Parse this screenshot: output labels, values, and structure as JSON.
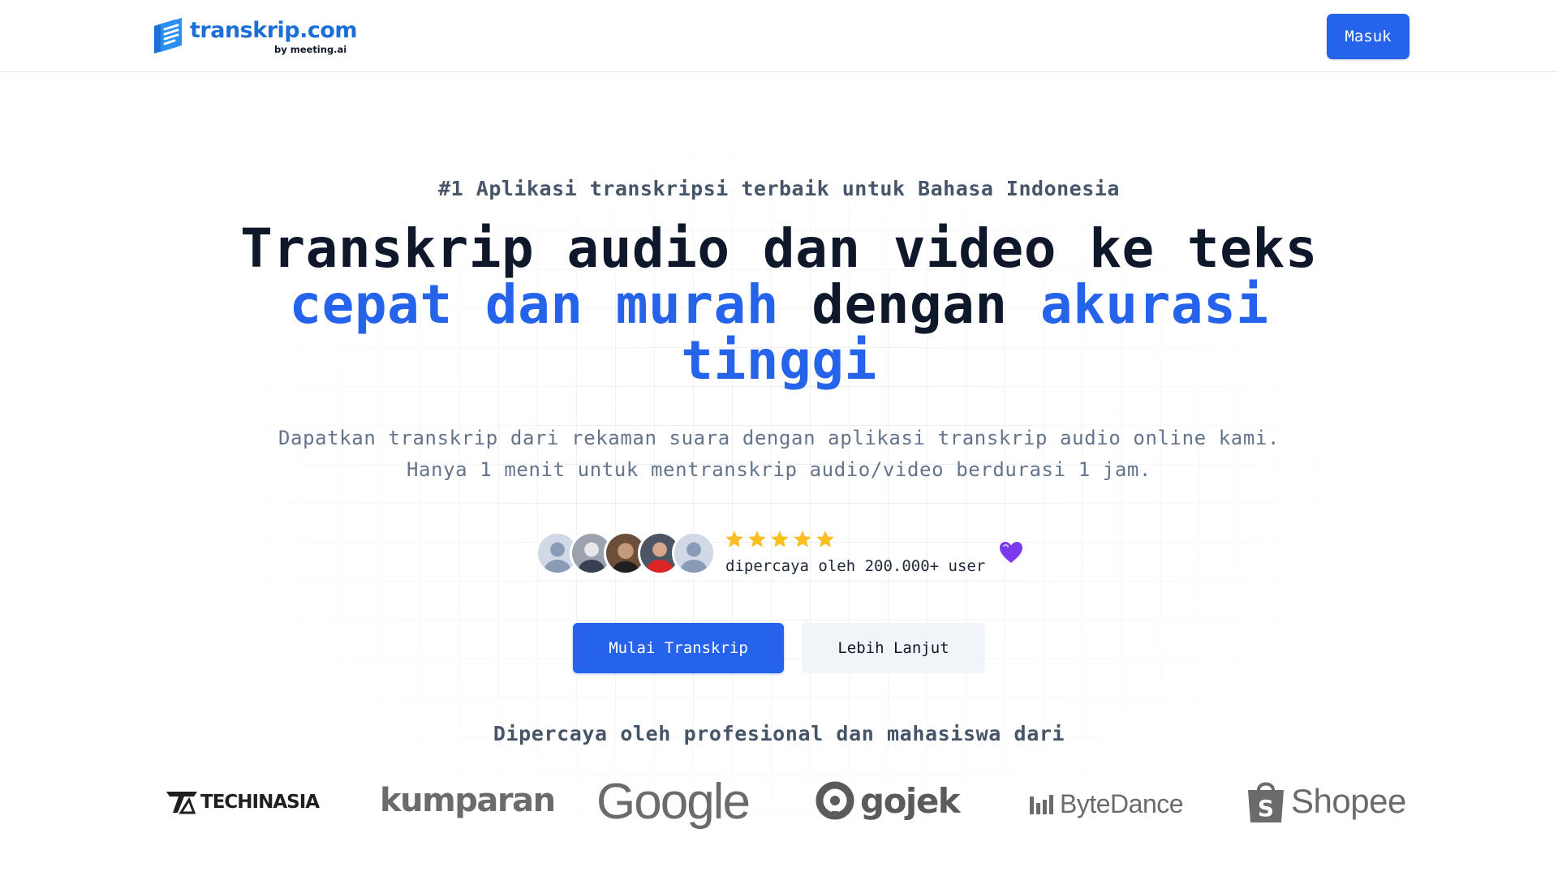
{
  "header": {
    "logo_word": "transkrip.com",
    "logo_sub": "by meeting.ai",
    "login_label": "Masuk"
  },
  "hero": {
    "tagline": "#1 Aplikasi transkripsi terbaik untuk Bahasa Indonesia",
    "headline": {
      "line1": "Transkrip audio dan video ke teks",
      "accent1": "cepat dan murah",
      "mid": "dengan",
      "accent2": "akurasi",
      "accent3": "tinggi"
    },
    "subtext": "Dapatkan transkrip dari rekaman suara dengan aplikasi transkrip audio online kami. Hanya 1 menit untuk mentranskrip audio/video berdurasi 1 jam.",
    "rating_stars": 5,
    "trust_text": "dipercaya oleh 200.000+ user",
    "primary_cta": "Mulai Transkrip",
    "secondary_cta": "Lebih Lanjut"
  },
  "trusted": {
    "heading": "Dipercaya oleh profesional dan mahasiswa dari",
    "brands": [
      {
        "name": "TECHINASIA",
        "icon": "techinasia-logo"
      },
      {
        "name": "kumparan",
        "icon": "kumparan-logo"
      },
      {
        "name": "Google",
        "icon": "google-logo"
      },
      {
        "name": "gojek",
        "icon": "gojek-logo"
      },
      {
        "name": "ByteDance",
        "icon": "bytedance-logo"
      },
      {
        "name": "Shopee",
        "icon": "shopee-logo"
      }
    ]
  },
  "colors": {
    "accent": "#2563eb",
    "logo_blue": "#1d6fd8",
    "star": "#fbbf24",
    "heart": "#7c3aed",
    "brand_gray": "#5b5b5b"
  }
}
